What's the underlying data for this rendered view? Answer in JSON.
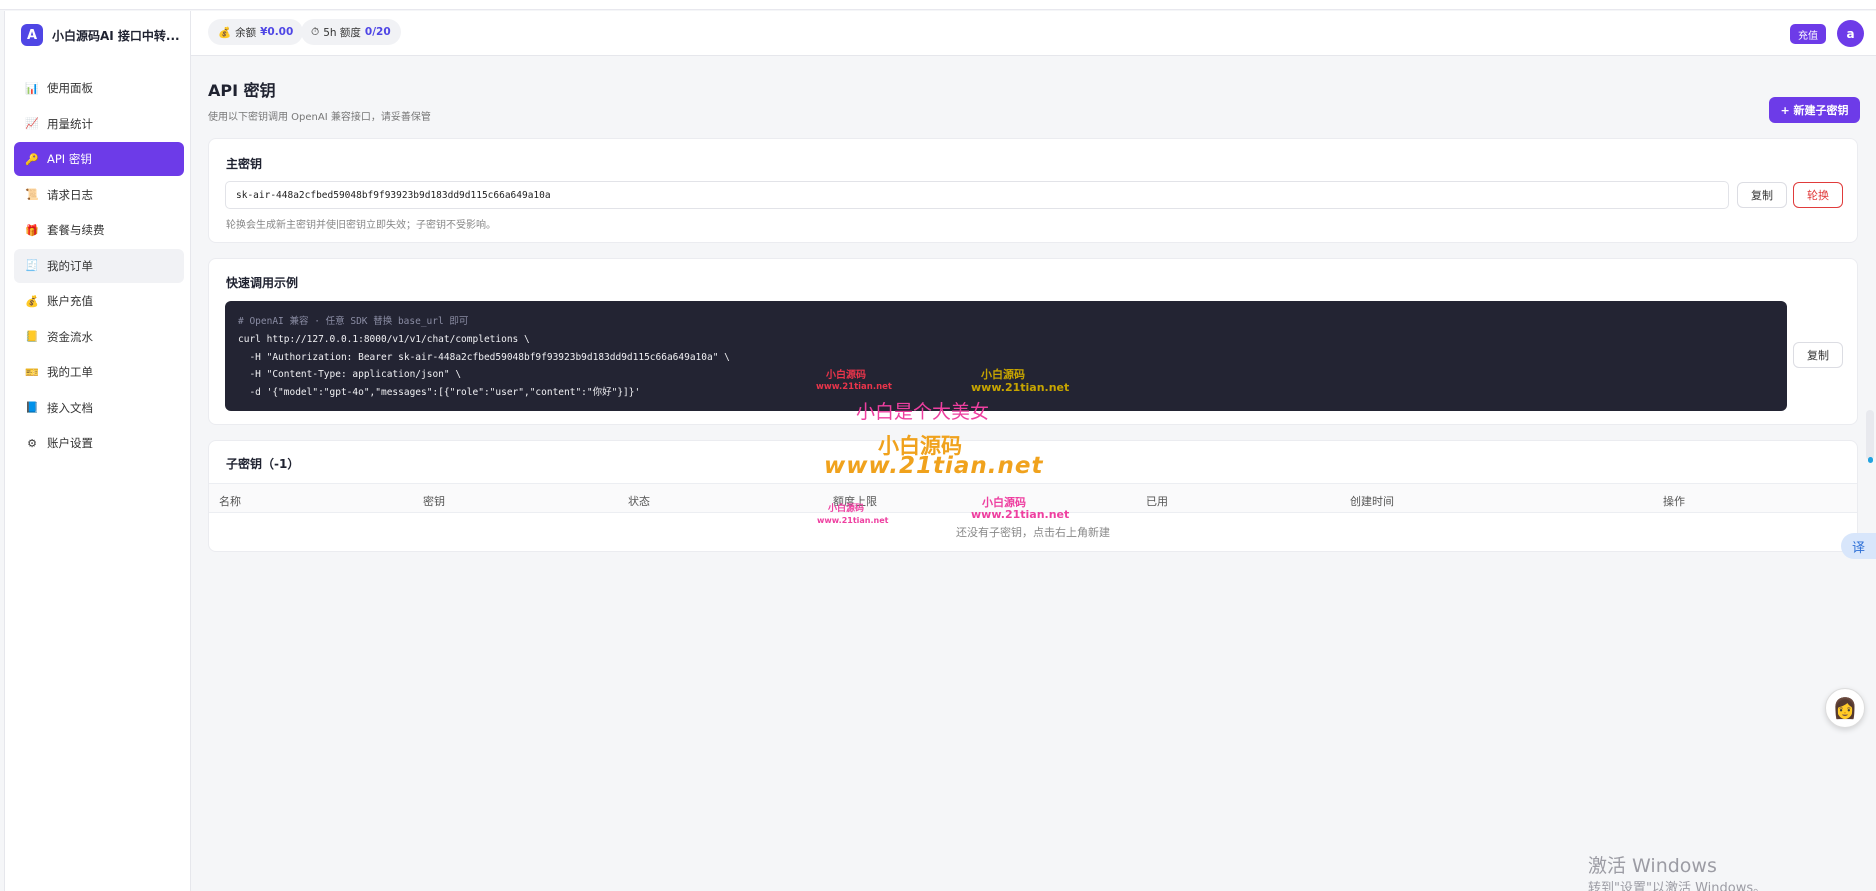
{
  "brand": {
    "logo_letter": "A",
    "name": "小白源码AI 接口中转..."
  },
  "sidebar": {
    "items": [
      {
        "icon": "bar-chart-icon",
        "glyph": "📊",
        "label": "使用面板"
      },
      {
        "icon": "line-chart-icon",
        "glyph": "📈",
        "label": "用量统计"
      },
      {
        "icon": "key-icon",
        "glyph": "🔑",
        "label": "API 密钥"
      },
      {
        "icon": "scroll-icon",
        "glyph": "📜",
        "label": "请求日志"
      },
      {
        "icon": "gift-icon",
        "glyph": "🎁",
        "label": "套餐与续费"
      },
      {
        "icon": "receipt-icon",
        "glyph": "🧾",
        "label": "我的订单"
      },
      {
        "icon": "money-bag-icon",
        "glyph": "💰",
        "label": "账户充值"
      },
      {
        "icon": "ledger-icon",
        "glyph": "📒",
        "label": "资金流水"
      },
      {
        "icon": "ticket-icon",
        "glyph": "🎫",
        "label": "我的工单"
      },
      {
        "icon": "book-icon",
        "glyph": "📘",
        "label": "接入文档"
      },
      {
        "icon": "gear-icon",
        "glyph": "⚙",
        "label": "账户设置"
      }
    ],
    "active_index": 2,
    "hover_index": 5
  },
  "header": {
    "balance_icon": "money-bag-icon",
    "balance_glyph": "💰",
    "balance_label": "余额",
    "balance_value": "¥0.00",
    "quota_icon": "timer-icon",
    "quota_glyph": "⏱",
    "quota_label": "5h 额度",
    "quota_value": "0/20",
    "recharge_label": "充值",
    "avatar_letter": "a"
  },
  "page": {
    "title": "API 密钥",
    "description": "使用以下密钥调用 OpenAI 兼容接口，请妥善保管",
    "new_key_button": "+ 新建子密钥"
  },
  "main_key": {
    "title": "主密钥",
    "value": "sk-air-448a2cfbed59048bf9f93923b9d183dd9d115c66a649a10a",
    "copy_label": "复制",
    "rotate_label": "轮换",
    "note": "轮换会生成新主密钥并使旧密钥立即失效；子密钥不受影响。"
  },
  "quick_example": {
    "title": "快速调用示例",
    "comment": "# OpenAI 兼容 · 任意 SDK 替换 base_url 即可",
    "lines": [
      "curl http://127.0.0.1:8000/v1/v1/chat/completions \\",
      "  -H \"Authorization: Bearer sk-air-448a2cfbed59048bf9f93923b9d183dd9d115c66a649a10a\" \\",
      "  -H \"Content-Type: application/json\" \\",
      "  -d '{\"model\":\"gpt-4o\",\"messages\":[{\"role\":\"user\",\"content\":\"你好\"}]}'"
    ],
    "copy_label": "复制"
  },
  "sub_keys": {
    "title": "子密钥（-1）",
    "columns": [
      "名称",
      "密钥",
      "状态",
      "额度上限",
      "已用",
      "创建时间",
      "操作"
    ],
    "empty_text": "还没有子密钥，点击右上角新建"
  },
  "watermarks": {
    "small_a_title": "小白源码",
    "small_a_url": "www.21tian.net",
    "small_b_title": "小白源码",
    "small_b_url": "www.21tian.net",
    "big_slogan": "小白是个大美女",
    "big_title": "小白源码",
    "big_url": "www.21tian.net",
    "small_c_title": "小白源码",
    "small_c_url": "www.21tian.net",
    "small_d_title": "小白源码",
    "small_d_url": "www.21tian.net"
  },
  "windows_activation": {
    "line1": "激活 Windows",
    "line2": "转到\"设置\"以激活 Windows。"
  },
  "floating": {
    "assistant_icon": "assistant-avatar-icon",
    "assistant_glyph": "👩",
    "translate_label": "译"
  }
}
